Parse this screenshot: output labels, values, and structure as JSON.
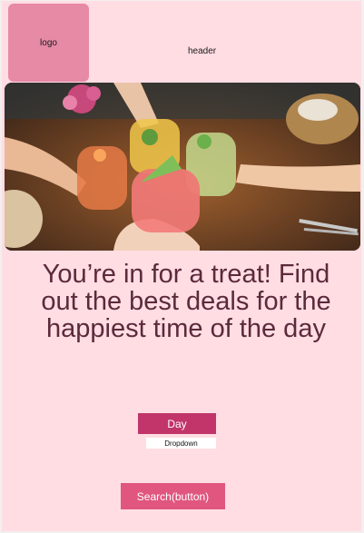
{
  "logo": {
    "label": "logo"
  },
  "header": {
    "label": "header"
  },
  "hero": {
    "image_subject": "friends toasting colorful cocktails with fruit"
  },
  "headline": {
    "text": "You’re in for a treat! Find out the best deals for the happiest time of the day"
  },
  "day_button": {
    "label": "Day"
  },
  "dropdown": {
    "label": "Dropdown"
  },
  "search_button": {
    "label": "Search(button)"
  },
  "colors": {
    "background": "#ffdde3",
    "logo": "#e68aa6",
    "day_button": "#c1356b",
    "search_button": "#e0567f",
    "headline": "#5b2a3b"
  }
}
